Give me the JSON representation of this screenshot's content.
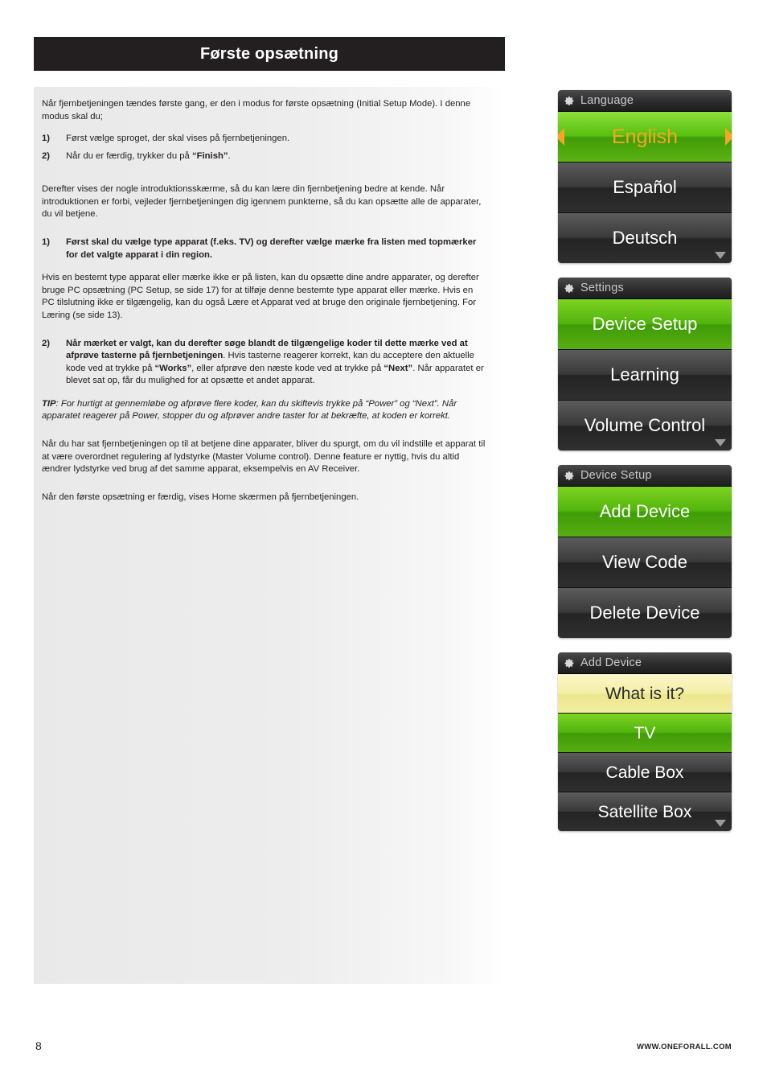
{
  "page": {
    "title": "Første opsætning",
    "number": "8",
    "footer_url": "WWW.ONEFORALL.COM"
  },
  "body": {
    "intro": "Når fjernbetjeningen tændes første gang, er den i modus for første opsætning (Initial Setup Mode). I denne modus skal du;",
    "steps1": [
      {
        "num": "1)",
        "text": "Først vælge sproget, der skal vises på fjernbetjeningen."
      },
      {
        "num": "2)",
        "text_before": "Når du er færdig, trykker du på ",
        "bold": "“Finish”",
        "text_after": "."
      }
    ],
    "para2": "Derefter vises der nogle introduktionsskærme, så du kan lære din fjernbetjening bedre at kende. Når introduktionen er forbi, vejleder fjernbetjeningen dig igennem punkterne, så du kan opsætte alle de apparater, du vil betjene.",
    "step_bold_1_num": "1)",
    "step_bold_1": "Først skal du vælge type apparat (f.eks. TV) og derefter vælge mærke fra listen med topmærker for det valgte apparat i din region.",
    "para3": "Hvis en bestemt type apparat eller mærke ikke er på listen, kan du opsætte dine andre apparater, og derefter bruge PC opsætning (PC Setup, se side 17) for at tilføje denne bestemte type apparat eller mærke. Hvis en PC tilslutning ikke er tilgængelig, kan du også Lære et Apparat ved at bruge den originale fjernbetjening. For Læring (se side 13).",
    "step_bold_2_num": "2)",
    "step2_bold_a": "Når mærket er valgt, kan du derefter søge blandt de tilgængelige koder til dette mærke ved at afprøve tasterne på fjernbetjeningen",
    "step2_rest_1": ". Hvis tasterne reagerer korrekt, kan du acceptere den aktuelle kode ved at trykke på ",
    "step2_bold_b": "“Works”",
    "step2_rest_2": ", eller afprøve den næste kode ved at trykke på ",
    "step2_bold_c": "“Next”",
    "step2_rest_3": ". Når apparatet er blevet sat op, får du mulighed for at opsætte et andet apparat.",
    "tip_label": "TIP",
    "tip_text": ": For hurtigt at gennemløbe og afprøve flere koder, kan du skiftevis trykke på “Power” og “Next”. Når apparatet reagerer på Power, stopper du og afprøver andre taster for at bekræfte, at koden er korrekt.",
    "para4": "Når du har sat fjernbetjeningen op til at betjene dine apparater, bliver du spurgt, om du vil indstille et apparat til at være overordnet regulering af lydstyrke (Master Volume control). Denne feature er nyttig, hvis du altid ændrer lydstyrke ved brug af det samme apparat, eksempelvis en AV Receiver.",
    "para5": "Når den første opsætning er færdig, vises Home skærmen på fjernbetjeningen."
  },
  "screens": [
    {
      "header": "Language",
      "icon": "gear-icon",
      "has_scroll": true,
      "rows": [
        {
          "label": "English",
          "style": "selected-orange"
        },
        {
          "label": "Español",
          "style": "dark"
        },
        {
          "label": "Deutsch",
          "style": "dark"
        }
      ]
    },
    {
      "header": "Settings",
      "icon": "gear-icon",
      "has_scroll": true,
      "rows": [
        {
          "label": "Device Setup",
          "style": "green"
        },
        {
          "label": "Learning",
          "style": "dark"
        },
        {
          "label": "Volume Control",
          "style": "dark"
        }
      ]
    },
    {
      "header": "Device Setup",
      "icon": "gear-icon",
      "has_scroll": false,
      "rows": [
        {
          "label": "Add Device",
          "style": "green"
        },
        {
          "label": "View Code",
          "style": "dark"
        },
        {
          "label": "Delete Device",
          "style": "dark"
        }
      ]
    },
    {
      "header": "Add Device",
      "icon": "gear-icon",
      "has_scroll": true,
      "rows": [
        {
          "label": "What is it?",
          "style": "yellow"
        },
        {
          "label": "TV",
          "style": "green-small"
        },
        {
          "label": "Cable Box",
          "style": "dark-small"
        },
        {
          "label": "Satellite Box",
          "style": "dark-small"
        }
      ]
    }
  ],
  "colors": {
    "header_bar": "#231f20",
    "green": "#52b50d",
    "highlight_orange": "#f5a623",
    "yellow": "#f2ecA0"
  }
}
